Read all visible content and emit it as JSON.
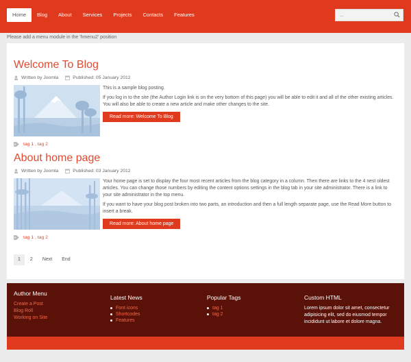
{
  "nav": {
    "items": [
      {
        "label": "Home",
        "active": true
      },
      {
        "label": "Blog",
        "active": false
      },
      {
        "label": "About",
        "active": false
      },
      {
        "label": "Services",
        "active": false
      },
      {
        "label": "Projects",
        "active": false
      },
      {
        "label": "Contacts",
        "active": false
      },
      {
        "label": "Features",
        "active": false
      }
    ],
    "search_placeholder": "..."
  },
  "notice": "Please add a menu module in the 'hmenu2' position",
  "articles": [
    {
      "title": "Welcome To Blog",
      "author": "Written by Joomla",
      "published": "Published: 05 January 2012",
      "paragraphs": [
        "This is a sample blog posting.",
        "If you log in to the site (the Author Login link is on the very bottom of this page) you will be able to edit it and all of the other existing articles. You will also be able to create a new article and make other changes to the site."
      ],
      "readmore": "Read more: Welcome To Blog",
      "tags": "tag 1 , tag 2"
    },
    {
      "title": "About home page",
      "author": "Written by Joomla",
      "published": "Published: 03 January 2012",
      "paragraphs": [
        "Your home page is set to display the four most recent articles from the blog category in a column. Then there are links to the 4 nest oldest articles. You can change those numbers by editing the content options settings in the blog tab in your site administrator. There is a link to your site administrator in the top menu.",
        "If you want to have your blog post broken into two parts, an introduction and then a full length separate page, use the Read More button to insert a break."
      ],
      "readmore": "Read more: About home page",
      "tags": "tag 1 , tag 2"
    }
  ],
  "pagination": [
    "1",
    "2",
    "Next",
    "End"
  ],
  "footer": {
    "author_menu": {
      "title": "Author Menu",
      "links": [
        "Create a Post",
        "Blog Roll",
        "Working on Site"
      ]
    },
    "latest_news": {
      "title": "Latest News",
      "items": [
        "Font icons",
        "Shortcodes",
        "Features"
      ]
    },
    "popular_tags": {
      "title": "Popular Tags",
      "items": [
        "tag 1",
        "tag 2"
      ]
    },
    "custom_html": {
      "title": "Custom HTML",
      "text": "Lorem ipsum dolor sit amet, consectetur adipisicing elit, sed do eiusmod tempor incididunt ut labore et dolore magna."
    }
  },
  "colors": {
    "accent": "#e03a1e",
    "footer_bg": "#5a1208",
    "title": "#e04a30"
  }
}
